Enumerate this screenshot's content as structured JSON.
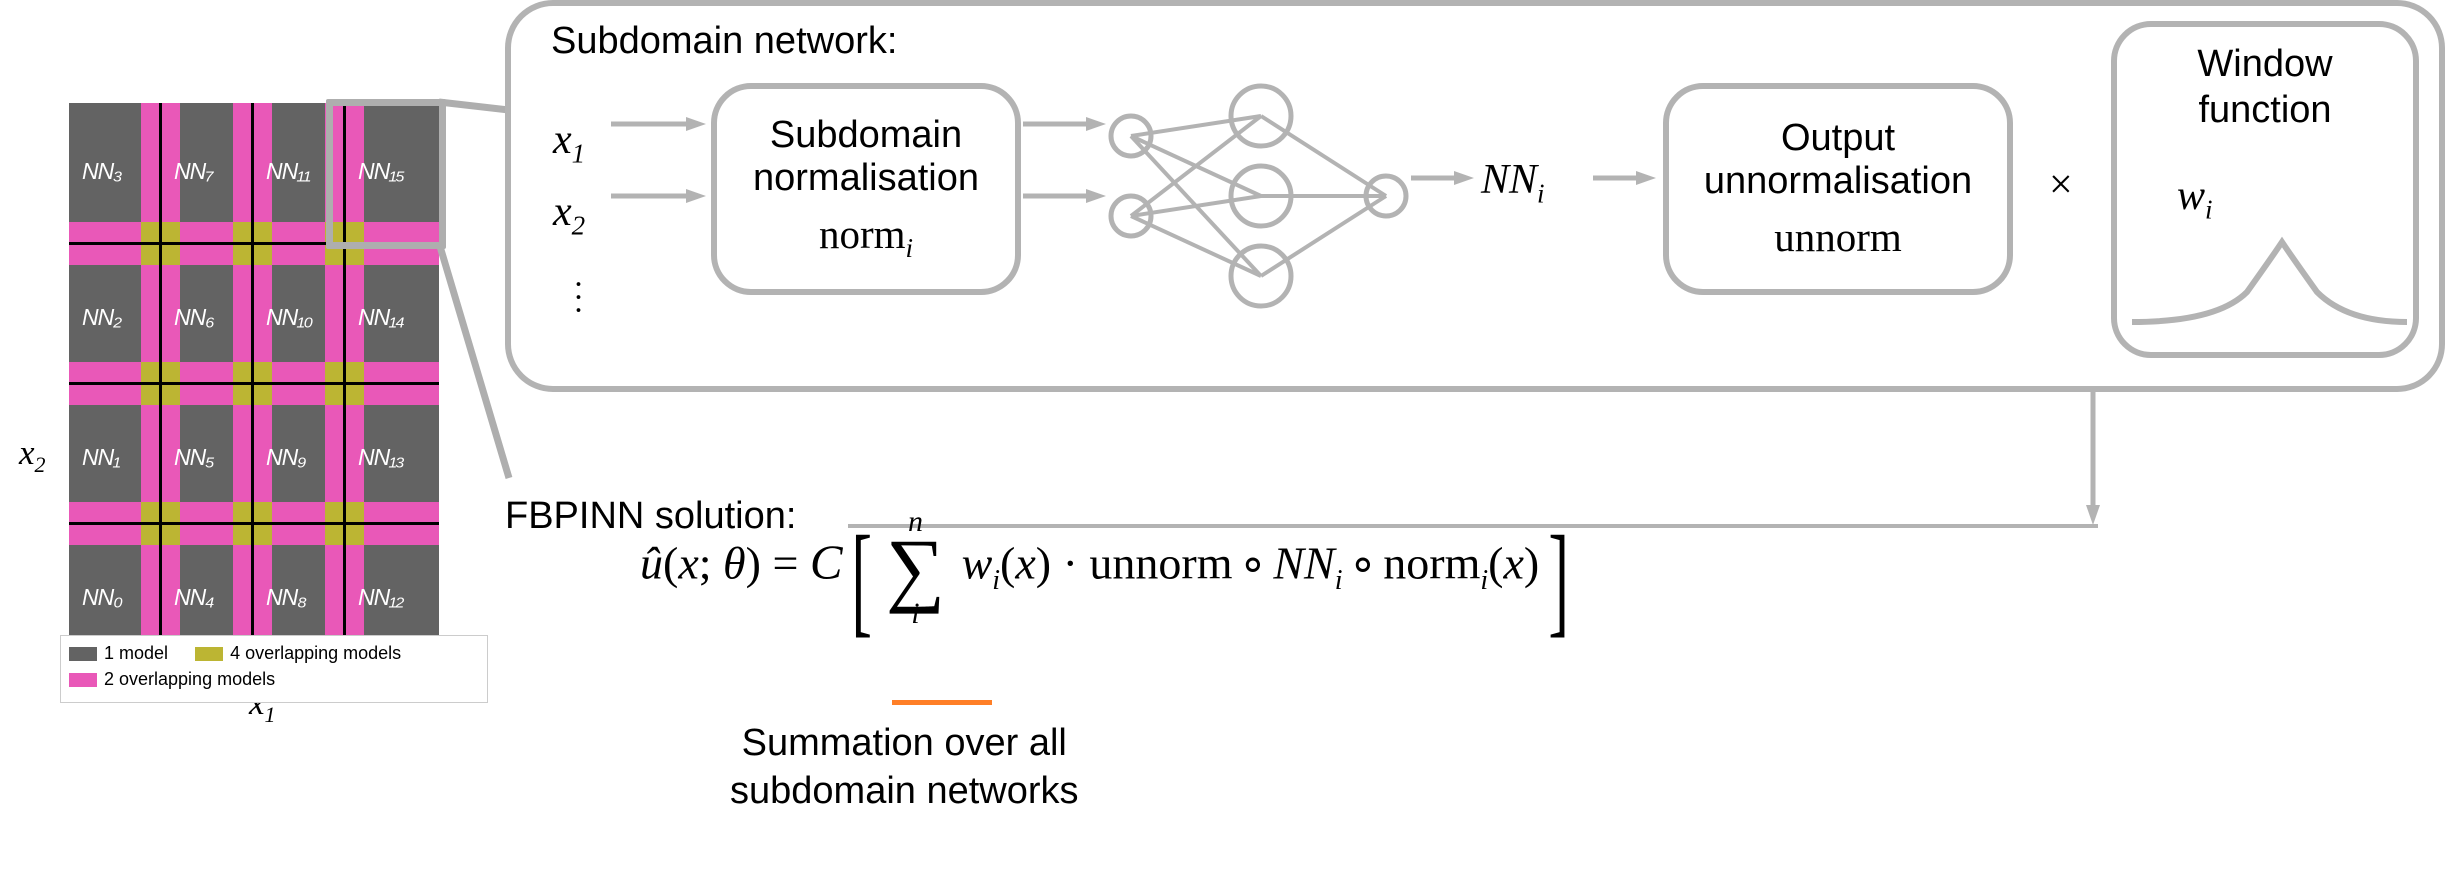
{
  "axes": {
    "x": "x₁",
    "y": "x₂"
  },
  "grid": {
    "cells": [
      "NN₀",
      "NN₁",
      "NN₂",
      "NN₃",
      "NN₄",
      "NN₅",
      "NN₆",
      "NN₇",
      "NN₈",
      "NN₉",
      "NN₁₀",
      "NN₁₁",
      "NN₁₂",
      "NN₁₃",
      "NN₁₄",
      "NN₁₅"
    ]
  },
  "legend": {
    "one": "1 model",
    "two": "2 overlapping models",
    "four": "4 overlapping models"
  },
  "subdomain": {
    "header": "Subdomain network:",
    "inputs": [
      "x₁",
      "x₂"
    ],
    "norm_box_line1": "Subdomain normalisation",
    "norm_box_line2": "normᵢ",
    "nn_out": "NNᵢ",
    "unnorm_line1": "Output unnormalisation",
    "unnorm_line2": "unnorm",
    "mul": "×",
    "window_title": "Window function",
    "window_wi": "wᵢ"
  },
  "solution": {
    "label": "FBPINN solution:",
    "formula_lhs": "û(x; θ) = 𝒞",
    "sigma_top": "n",
    "sigma_bot": "i",
    "formula_body": "wᵢ(x) · unnorm ∘ NNᵢ ∘ normᵢ(x)",
    "note": "Summation over all subdomain networks"
  }
}
